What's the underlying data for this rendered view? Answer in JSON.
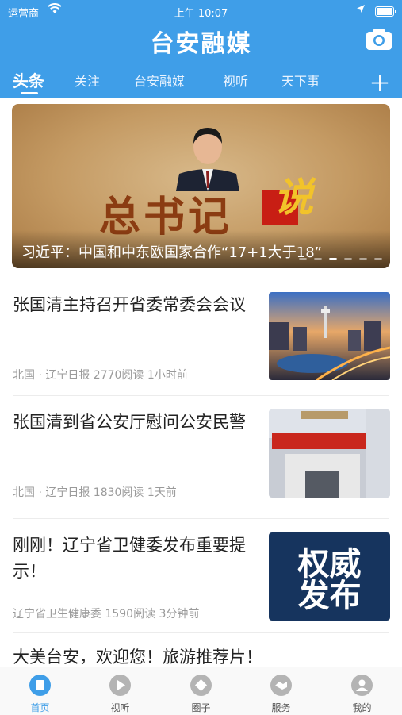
{
  "status_bar": {
    "carrier": "运营商",
    "time": "上午 10:07"
  },
  "header": {
    "logo_text": "台安融媒",
    "camera_icon": "camera-icon"
  },
  "tabs": [
    {
      "label": "头条",
      "active": true
    },
    {
      "label": "关注"
    },
    {
      "label": "台安融媒"
    },
    {
      "label": "视听"
    },
    {
      "label": "天下事"
    }
  ],
  "banner": {
    "headline_art": "总书记",
    "headline_art_accent": "说",
    "caption": "习近平：中国和中东欧国家合作“17+1大于18”",
    "dot_count": 6,
    "active_dot": 2
  },
  "news": [
    {
      "title": "张国清主持召开省委常委会会议",
      "meta": "北国 · 辽宁日报 2770阅读 1小时前",
      "thumb": "city-skyline-night"
    },
    {
      "title": "张国清到省公安厅慰问公安民警",
      "meta": "北国 · 辽宁日报 1830阅读 1天前",
      "thumb": "government-building"
    },
    {
      "title": "刚刚！辽宁省卫健委发布重要提示！",
      "meta": "辽宁省卫生健康委 1590阅读 3分钟前",
      "thumb": "authority-release",
      "thumb_text_1": "权威",
      "thumb_text_2": "发布"
    },
    {
      "title": "大美台安，欢迎您！旅游推荐片！"
    }
  ],
  "tabbar": [
    {
      "label": "首页",
      "icon": "home-icon",
      "active": true
    },
    {
      "label": "视听",
      "icon": "play-icon"
    },
    {
      "label": "圈子",
      "icon": "circle-icon"
    },
    {
      "label": "服务",
      "icon": "handshake-icon"
    },
    {
      "label": "我的",
      "icon": "user-icon"
    }
  ],
  "colors": {
    "brand": "#3f9ee8",
    "banner_red": "#c81e14",
    "banner_gold": "#f2c32a"
  }
}
